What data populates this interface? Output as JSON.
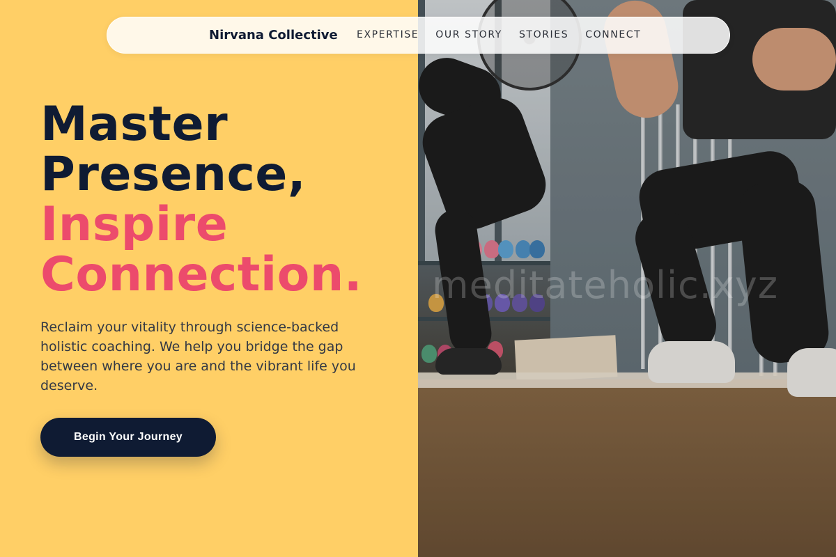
{
  "nav": {
    "brand": "Nirvana Collective",
    "links": [
      "EXPERTISE",
      "OUR STORY",
      "STORIES",
      "CONNECT"
    ]
  },
  "hero": {
    "headline_line1": "Master",
    "headline_line2": "Presence,",
    "headline_accent1": "Inspire",
    "headline_accent2": "Connection.",
    "subtext": "Reclaim your vitality through science-backed holistic coaching. We help you bridge the gap between where you are and the vibrant life you deserve.",
    "cta_label": "Begin Your Journey"
  },
  "image": {
    "watermark": "meditateholic.xyz"
  },
  "colors": {
    "background": "#FFCF66",
    "dark": "#0f1b33",
    "accent": "#EC4B6C"
  }
}
